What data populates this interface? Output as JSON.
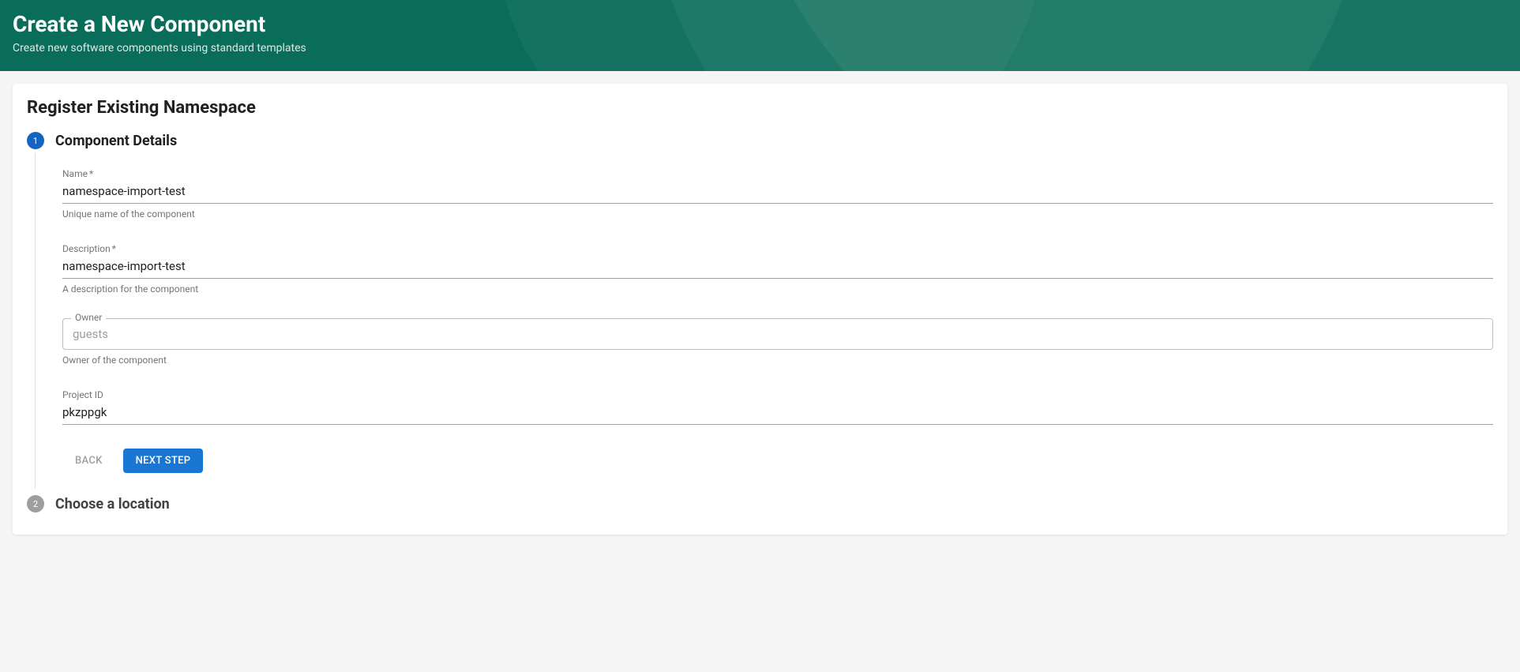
{
  "banner": {
    "title": "Create a New Component",
    "subtitle": "Create new software components using standard templates"
  },
  "card": {
    "title": "Register Existing Namespace"
  },
  "steps": [
    {
      "num": "1",
      "title": "Component Details"
    },
    {
      "num": "2",
      "title": "Choose a location"
    }
  ],
  "form": {
    "name": {
      "label": "Name",
      "required": "*",
      "value": "namespace-import-test",
      "helper": "Unique name of the component"
    },
    "description": {
      "label": "Description",
      "required": "*",
      "value": "namespace-import-test",
      "helper": "A description for the component"
    },
    "owner": {
      "label": "Owner",
      "placeholder": "guests",
      "value": "",
      "helper": "Owner of the component"
    },
    "projectId": {
      "label": "Project ID",
      "value": "pkzppgk"
    }
  },
  "actions": {
    "back": "Back",
    "next": "Next Step"
  }
}
